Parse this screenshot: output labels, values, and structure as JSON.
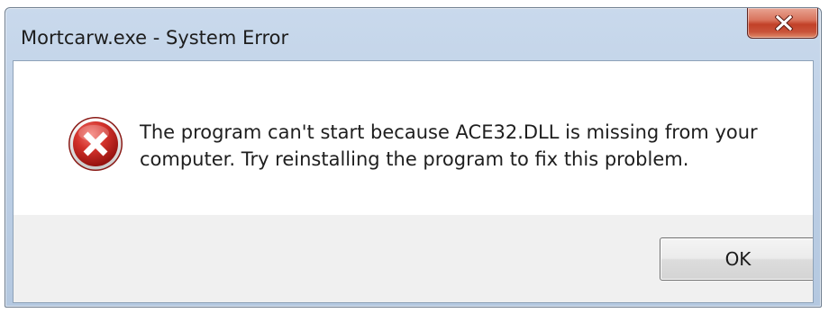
{
  "window": {
    "title": "Mortcarw.exe - System Error"
  },
  "titlebar": {
    "close_icon": "close-x-icon"
  },
  "dialog": {
    "icon": "error-icon",
    "message_line1": "The program can't start because ACE32.DLL is missing from your",
    "message_line2": "computer. Try reinstalling the program to fix this problem.",
    "ok_label": "OK"
  },
  "colors": {
    "close_button": "#c9533a",
    "error_icon": "#c8201f",
    "button_area": "#f0f0f0",
    "titlebar": "#bed0e6"
  }
}
